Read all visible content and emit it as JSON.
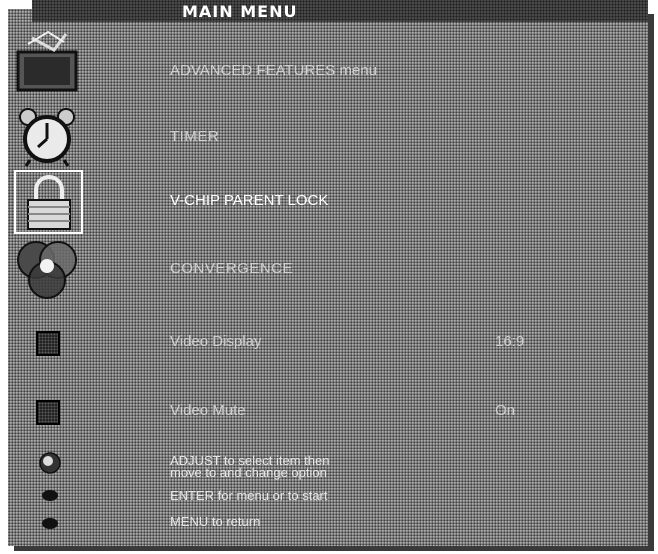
{
  "title": "MAIN MENU",
  "menu": {
    "advanced_features": "ADVANCED FEATURES menu",
    "timer": "TIMER",
    "v_chip": "V-CHIP PARENT LOCK",
    "convergence": "CONVERGENCE",
    "video_display": {
      "label": "Video Display",
      "value": "16:9"
    },
    "video_mute": {
      "label": "Video Mute",
      "value": "On"
    }
  },
  "help": {
    "adjust_line1": "ADJUST to select item then",
    "adjust_line2": "move to and change option",
    "enter": "ENTER for menu or to start",
    "menu": "MENU to return"
  },
  "icons": {
    "advanced_features": "tv-set-icon",
    "timer": "alarm-clock-icon",
    "v_chip": "padlock-icon",
    "convergence": "rgb-circles-icon",
    "video_display": "square-icon",
    "video_mute": "square-icon",
    "adjust": "joystick-icon",
    "enter": "enter-button-icon",
    "menu": "menu-button-icon"
  },
  "colors": {
    "background": "#8b8b8b",
    "text": "#cfcfcf",
    "highlight": "#ffffff",
    "title_bar": "#4a4a4a"
  }
}
